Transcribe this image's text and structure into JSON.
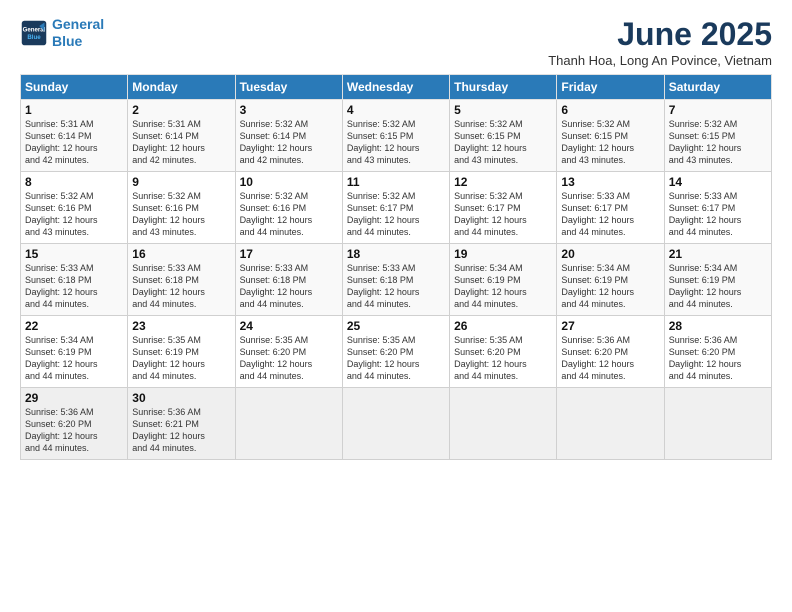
{
  "logo": {
    "line1": "General",
    "line2": "Blue"
  },
  "title": "June 2025",
  "subtitle": "Thanh Hoa, Long An Povince, Vietnam",
  "days_of_week": [
    "Sunday",
    "Monday",
    "Tuesday",
    "Wednesday",
    "Thursday",
    "Friday",
    "Saturday"
  ],
  "weeks": [
    [
      {
        "day": "1",
        "detail": "Sunrise: 5:31 AM\nSunset: 6:14 PM\nDaylight: 12 hours\nand 42 minutes."
      },
      {
        "day": "2",
        "detail": "Sunrise: 5:31 AM\nSunset: 6:14 PM\nDaylight: 12 hours\nand 42 minutes."
      },
      {
        "day": "3",
        "detail": "Sunrise: 5:32 AM\nSunset: 6:14 PM\nDaylight: 12 hours\nand 42 minutes."
      },
      {
        "day": "4",
        "detail": "Sunrise: 5:32 AM\nSunset: 6:15 PM\nDaylight: 12 hours\nand 43 minutes."
      },
      {
        "day": "5",
        "detail": "Sunrise: 5:32 AM\nSunset: 6:15 PM\nDaylight: 12 hours\nand 43 minutes."
      },
      {
        "day": "6",
        "detail": "Sunrise: 5:32 AM\nSunset: 6:15 PM\nDaylight: 12 hours\nand 43 minutes."
      },
      {
        "day": "7",
        "detail": "Sunrise: 5:32 AM\nSunset: 6:15 PM\nDaylight: 12 hours\nand 43 minutes."
      }
    ],
    [
      {
        "day": "8",
        "detail": "Sunrise: 5:32 AM\nSunset: 6:16 PM\nDaylight: 12 hours\nand 43 minutes."
      },
      {
        "day": "9",
        "detail": "Sunrise: 5:32 AM\nSunset: 6:16 PM\nDaylight: 12 hours\nand 43 minutes."
      },
      {
        "day": "10",
        "detail": "Sunrise: 5:32 AM\nSunset: 6:16 PM\nDaylight: 12 hours\nand 44 minutes."
      },
      {
        "day": "11",
        "detail": "Sunrise: 5:32 AM\nSunset: 6:17 PM\nDaylight: 12 hours\nand 44 minutes."
      },
      {
        "day": "12",
        "detail": "Sunrise: 5:32 AM\nSunset: 6:17 PM\nDaylight: 12 hours\nand 44 minutes."
      },
      {
        "day": "13",
        "detail": "Sunrise: 5:33 AM\nSunset: 6:17 PM\nDaylight: 12 hours\nand 44 minutes."
      },
      {
        "day": "14",
        "detail": "Sunrise: 5:33 AM\nSunset: 6:17 PM\nDaylight: 12 hours\nand 44 minutes."
      }
    ],
    [
      {
        "day": "15",
        "detail": "Sunrise: 5:33 AM\nSunset: 6:18 PM\nDaylight: 12 hours\nand 44 minutes."
      },
      {
        "day": "16",
        "detail": "Sunrise: 5:33 AM\nSunset: 6:18 PM\nDaylight: 12 hours\nand 44 minutes."
      },
      {
        "day": "17",
        "detail": "Sunrise: 5:33 AM\nSunset: 6:18 PM\nDaylight: 12 hours\nand 44 minutes."
      },
      {
        "day": "18",
        "detail": "Sunrise: 5:33 AM\nSunset: 6:18 PM\nDaylight: 12 hours\nand 44 minutes."
      },
      {
        "day": "19",
        "detail": "Sunrise: 5:34 AM\nSunset: 6:19 PM\nDaylight: 12 hours\nand 44 minutes."
      },
      {
        "day": "20",
        "detail": "Sunrise: 5:34 AM\nSunset: 6:19 PM\nDaylight: 12 hours\nand 44 minutes."
      },
      {
        "day": "21",
        "detail": "Sunrise: 5:34 AM\nSunset: 6:19 PM\nDaylight: 12 hours\nand 44 minutes."
      }
    ],
    [
      {
        "day": "22",
        "detail": "Sunrise: 5:34 AM\nSunset: 6:19 PM\nDaylight: 12 hours\nand 44 minutes."
      },
      {
        "day": "23",
        "detail": "Sunrise: 5:35 AM\nSunset: 6:19 PM\nDaylight: 12 hours\nand 44 minutes."
      },
      {
        "day": "24",
        "detail": "Sunrise: 5:35 AM\nSunset: 6:20 PM\nDaylight: 12 hours\nand 44 minutes."
      },
      {
        "day": "25",
        "detail": "Sunrise: 5:35 AM\nSunset: 6:20 PM\nDaylight: 12 hours\nand 44 minutes."
      },
      {
        "day": "26",
        "detail": "Sunrise: 5:35 AM\nSunset: 6:20 PM\nDaylight: 12 hours\nand 44 minutes."
      },
      {
        "day": "27",
        "detail": "Sunrise: 5:36 AM\nSunset: 6:20 PM\nDaylight: 12 hours\nand 44 minutes."
      },
      {
        "day": "28",
        "detail": "Sunrise: 5:36 AM\nSunset: 6:20 PM\nDaylight: 12 hours\nand 44 minutes."
      }
    ],
    [
      {
        "day": "29",
        "detail": "Sunrise: 5:36 AM\nSunset: 6:20 PM\nDaylight: 12 hours\nand 44 minutes."
      },
      {
        "day": "30",
        "detail": "Sunrise: 5:36 AM\nSunset: 6:21 PM\nDaylight: 12 hours\nand 44 minutes."
      },
      {
        "day": "",
        "detail": ""
      },
      {
        "day": "",
        "detail": ""
      },
      {
        "day": "",
        "detail": ""
      },
      {
        "day": "",
        "detail": ""
      },
      {
        "day": "",
        "detail": ""
      }
    ]
  ]
}
